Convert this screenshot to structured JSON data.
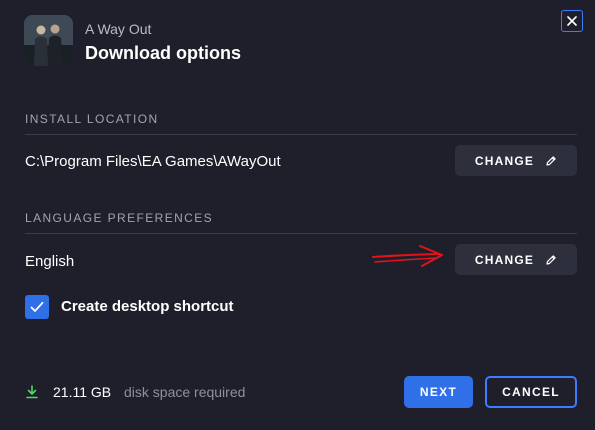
{
  "header": {
    "game_name": "A Way Out",
    "title": "Download options"
  },
  "install_location": {
    "section_label": "INSTALL LOCATION",
    "path": "C:\\Program Files\\EA Games\\AWayOut",
    "change_label": "CHANGE"
  },
  "language": {
    "section_label": "LANGUAGE PREFERENCES",
    "value": "English",
    "change_label": "CHANGE"
  },
  "shortcut": {
    "label": "Create desktop shortcut",
    "checked": true
  },
  "footer": {
    "disk_size": "21.11 GB",
    "disk_text": "disk space required",
    "next_label": "NEXT",
    "cancel_label": "CANCEL"
  },
  "icons": {
    "close": "close-icon",
    "edit": "pencil-icon",
    "check": "checkmark-icon",
    "download": "download-arrow-icon",
    "annotation": "red-arrow-annotation"
  },
  "colors": {
    "background": "#1e1f2b",
    "accent": "#2f6fe8",
    "button_bg": "#2d2f3d",
    "download_green": "#4cd964",
    "annotation_red": "#e0141a"
  }
}
